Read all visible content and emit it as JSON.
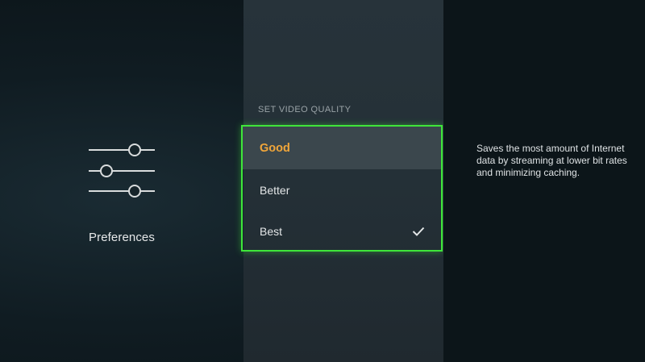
{
  "preferences": {
    "label": "Preferences",
    "icon": "sliders-icon"
  },
  "video_quality": {
    "heading": "SET VIDEO QUALITY",
    "options": [
      {
        "label": "Good",
        "focused": true,
        "selected": false
      },
      {
        "label": "Better",
        "focused": false,
        "selected": false
      },
      {
        "label": "Best",
        "focused": false,
        "selected": true
      }
    ],
    "description": "Saves the most amount of Internet data by streaming at lower bit rates and minimizing caching."
  },
  "colors": {
    "focus_border": "#3fe63a",
    "focused_text": "#f1a63a",
    "text": "#e4e7e8"
  }
}
